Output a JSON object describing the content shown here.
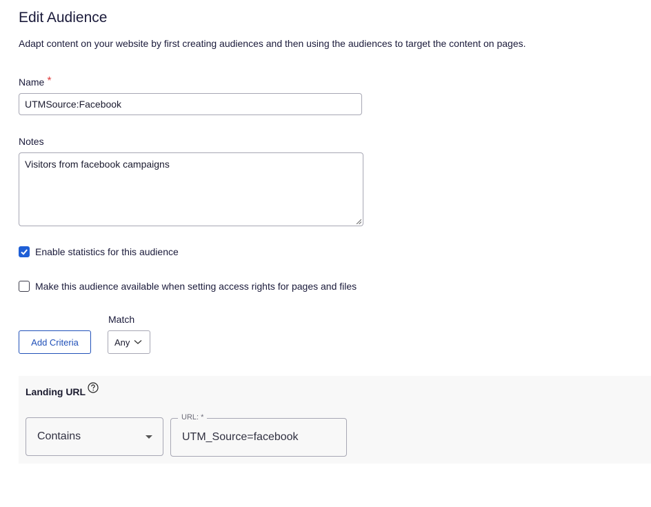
{
  "header": {
    "title": "Edit Audience",
    "description": "Adapt content on your website by first creating audiences and then using the audiences to target the content on pages."
  },
  "form": {
    "name_label": "Name",
    "name_required_mark": "*",
    "name_value": "UTMSource:Facebook",
    "notes_label": "Notes",
    "notes_value": "Visitors from facebook campaigns",
    "enable_statistics_label": "Enable statistics for this audience",
    "enable_statistics_checked": true,
    "access_rights_label": "Make this audience available when setting access rights for pages and files",
    "access_rights_checked": false
  },
  "criteria_controls": {
    "add_criteria_label": "Add Criteria",
    "match_label": "Match",
    "match_value": "Any"
  },
  "criterion": {
    "title": "Landing URL",
    "help_icon": "question-circle-icon",
    "operator_value": "Contains",
    "url_legend": "URL: *",
    "url_value": "UTM_Source=facebook"
  },
  "colors": {
    "accent": "#1f5fd6",
    "button_text": "#1f4fb8",
    "required": "#e03e3e",
    "panel_bg": "#f8f8f8"
  }
}
